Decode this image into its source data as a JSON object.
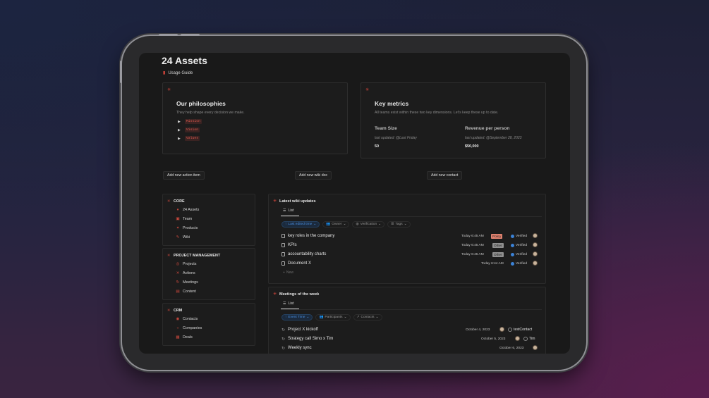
{
  "page": {
    "title": "24 Assets",
    "usage_guide": "Usage Guide"
  },
  "philosophies": {
    "title": "Our philosophies",
    "subtitle": "They help shape every decision we make.",
    "items": [
      "Mission",
      "Vision",
      "Values"
    ]
  },
  "metrics": {
    "title": "Key metrics",
    "subtitle": "All teams exist within these two key dimensions. Let's keep these up to date.",
    "team_size": {
      "label": "Team Size",
      "updated": "last updated: @Last Friday",
      "value": "50"
    },
    "revenue": {
      "label": "Revenue per person",
      "updated": "last updated: @September 28, 2023",
      "value": "$50,000"
    }
  },
  "actions": {
    "add_action": "Add new action item",
    "add_wiki": "Add new wiki doc",
    "add_contact": "Add new contact"
  },
  "sidebar": {
    "core": {
      "label": "CORE",
      "items": [
        "24 Assets",
        "Team",
        "Products",
        "Wiki"
      ]
    },
    "pm": {
      "label": "PROJECT MANAGEMENT",
      "items": [
        "Projects",
        "Actions",
        "Meetings",
        "Content"
      ]
    },
    "crm": {
      "label": "CRM",
      "items": [
        "Contacts",
        "Companies",
        "Deals"
      ]
    }
  },
  "wiki": {
    "title": "Latest wiki updates",
    "tab": "List",
    "filters": [
      "Last edited time",
      "Owner",
      "Verification",
      "Tags"
    ],
    "rows": [
      {
        "name": "key roles in the company",
        "time": "Today 6:45 AM",
        "tag": "Policy",
        "status": "Verified"
      },
      {
        "name": "KPIs",
        "time": "Today 6:45 AM",
        "tag": "Other",
        "status": "Verified"
      },
      {
        "name": "accountability charts",
        "time": "Today 6:45 AM",
        "tag": "Other",
        "status": "Verified"
      },
      {
        "name": "Document X",
        "time": "Today 6:44 AM",
        "tag": "",
        "status": "Verified"
      }
    ],
    "new_label": "New"
  },
  "meetings": {
    "title": "Meetings of the week",
    "tab": "List",
    "filters": [
      "Event Time",
      "Participants",
      "Contacts"
    ],
    "rows": [
      {
        "name": "Project X kickoff",
        "date": "October 4, 2023",
        "contact": "testContact"
      },
      {
        "name": "Strategy call Simo x Tim",
        "date": "October 5, 2023",
        "contact": "Tim"
      },
      {
        "name": "Weekly sync",
        "date": "October 6, 2023",
        "contact": ""
      }
    ]
  },
  "colors": {
    "accent": "#e0483d",
    "badge_policy": "#e0826f",
    "badge_other": "#8f8f8f",
    "verified": "#3b82d6"
  }
}
